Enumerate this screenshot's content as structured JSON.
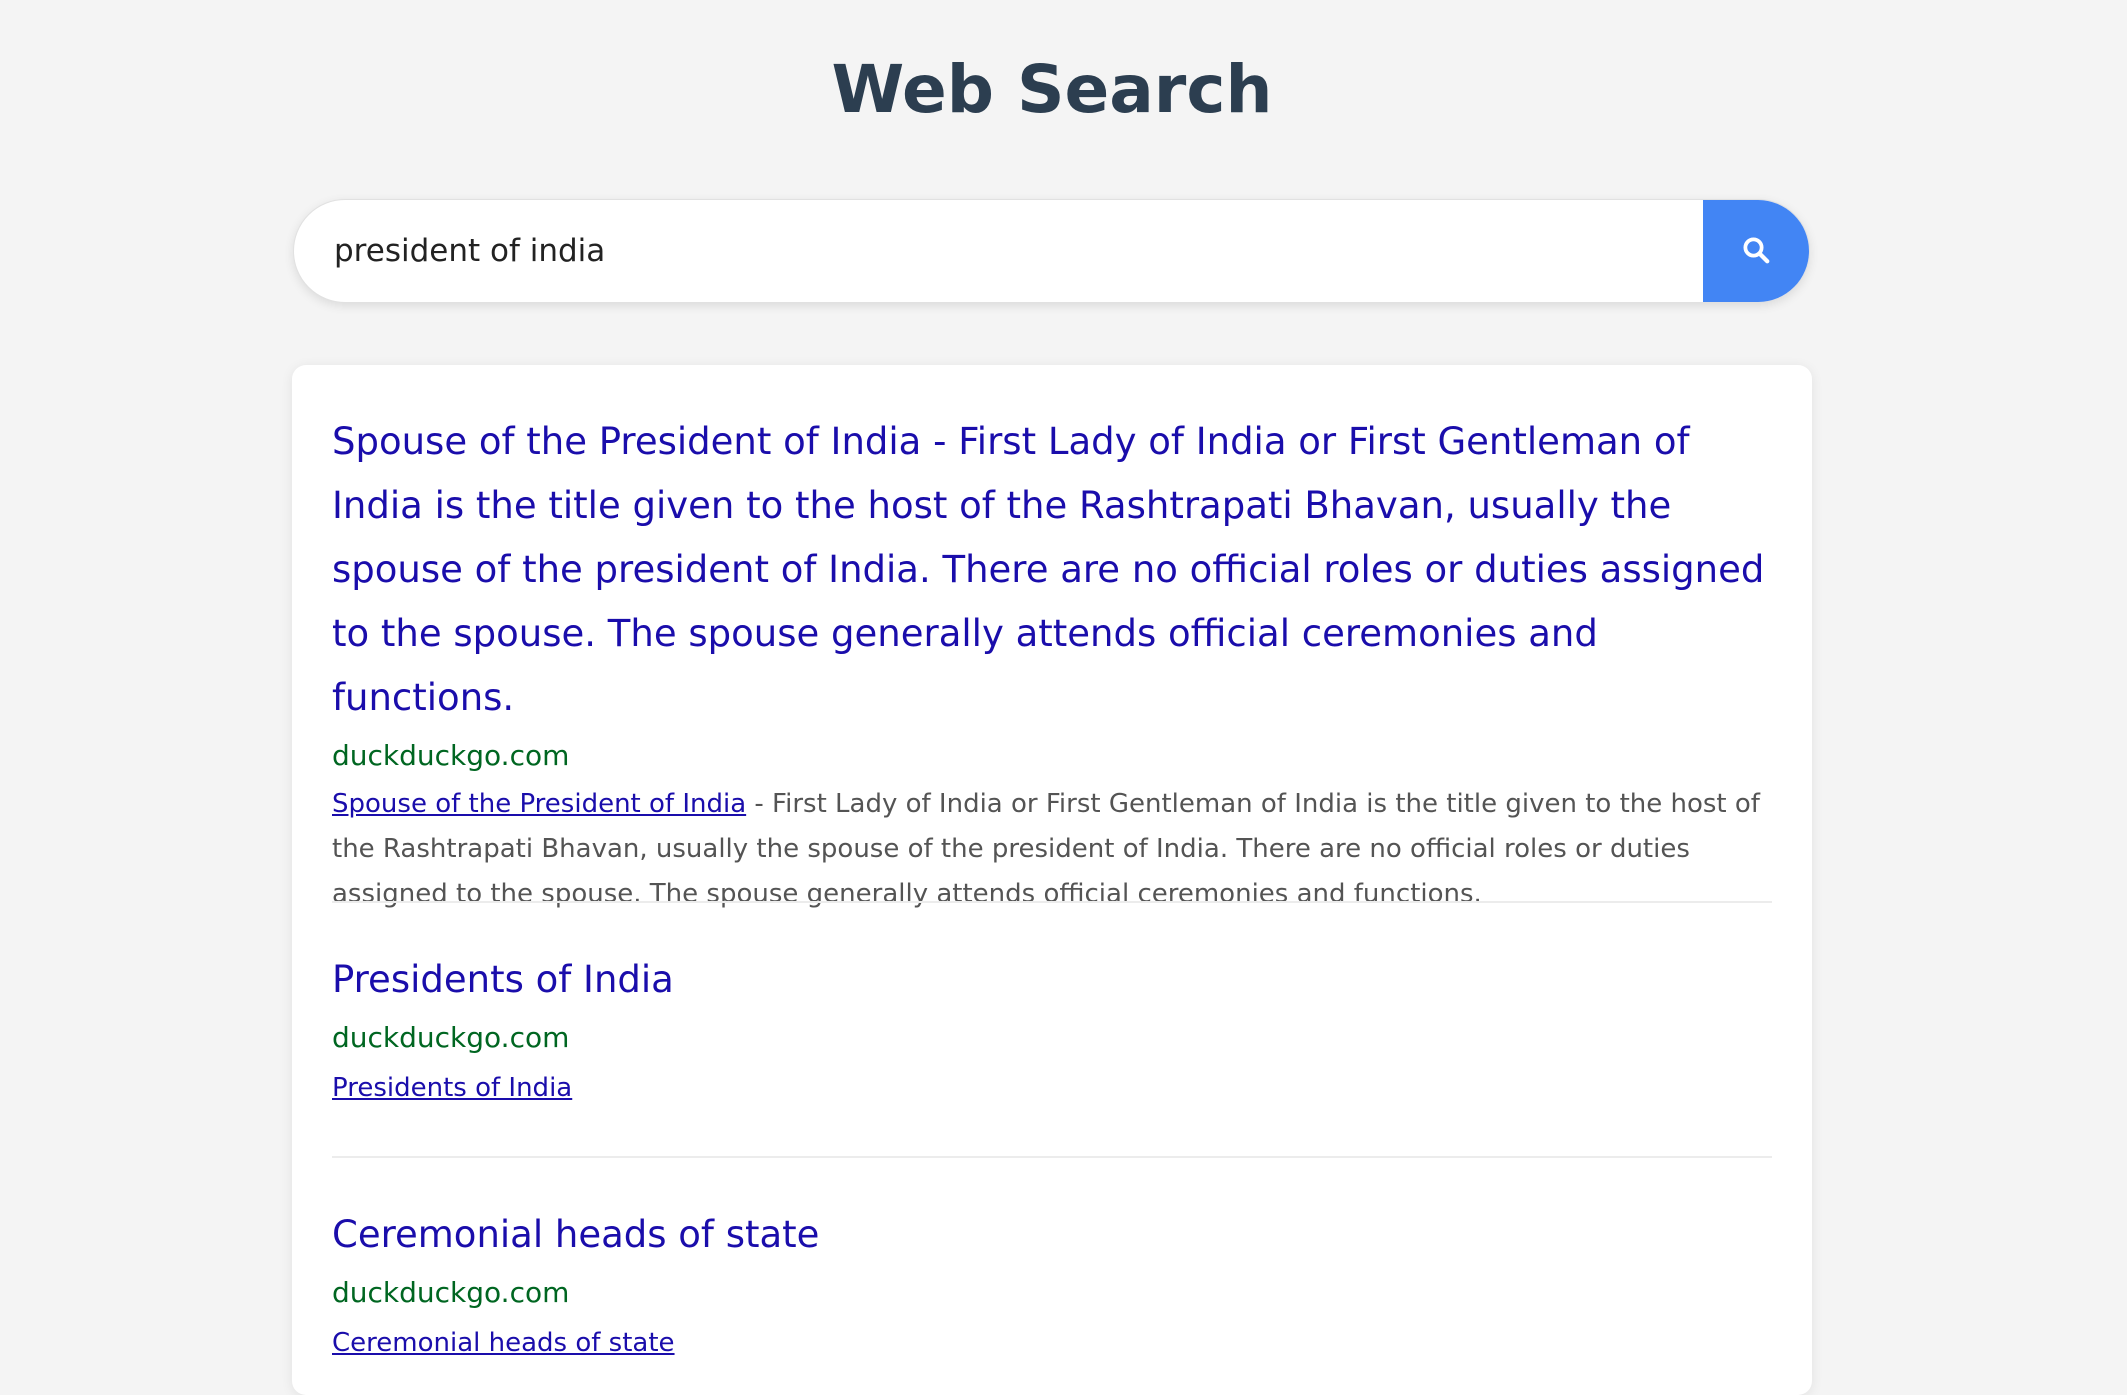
{
  "page": {
    "title": "Web Search"
  },
  "search": {
    "query": "president of india",
    "button_icon": "search-icon"
  },
  "colors": {
    "background": "#f4f4f4",
    "title": "#2c3e50",
    "accent": "#4285f4",
    "result_title": "#1a0dab",
    "result_url": "#006621",
    "snippet_text": "#545454"
  },
  "results": [
    {
      "title": "Spouse of the President of India - First Lady of India or First Gentleman of India is the title given to the host of the Rashtrapati Bhavan, usually the spouse of the president of India. There are no official roles or duties assigned to the spouse. The spouse generally attends official ceremonies and functions.",
      "url": "duckduckgo.com",
      "snippet_link": "Spouse of the President of India",
      "snippet_text": " - First Lady of India or First Gentleman of India is the title given to the host of the Rashtrapati Bhavan, usually the spouse of the president of India. There are no official roles or duties assigned to the spouse. The spouse generally attends official ceremonies and functions."
    },
    {
      "title": "Presidents of India",
      "url": "duckduckgo.com",
      "snippet_link": "Presidents of India",
      "snippet_text": ""
    },
    {
      "title": "Ceremonial heads of state",
      "url": "duckduckgo.com",
      "snippet_link": "Ceremonial heads of state",
      "snippet_text": ""
    }
  ]
}
